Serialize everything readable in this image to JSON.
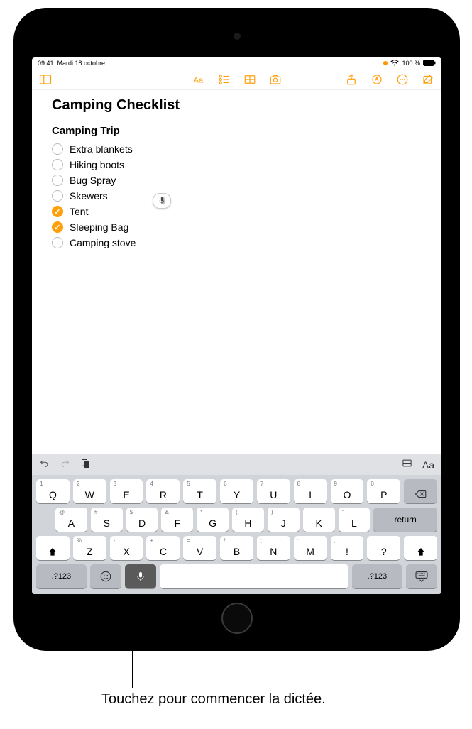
{
  "status": {
    "time": "09:41",
    "date": "Mardi 18 octobre",
    "battery": "100 %",
    "wifi": "wifi-icon"
  },
  "toolbar": {
    "left": [
      "sidebar-icon"
    ],
    "center": [
      "text-format-icon",
      "checklist-icon",
      "table-icon",
      "camera-icon"
    ],
    "right": [
      "share-icon",
      "markup-icon",
      "more-icon",
      "compose-icon"
    ]
  },
  "note": {
    "title": "Camping Checklist",
    "subtitle": "Camping Trip",
    "items": [
      {
        "label": "Extra blankets",
        "checked": false
      },
      {
        "label": "Hiking boots",
        "checked": false
      },
      {
        "label": "Bug Spray",
        "checked": false
      },
      {
        "label": "Skewers",
        "checked": false
      },
      {
        "label": "Tent",
        "checked": true
      },
      {
        "label": "Sleeping Bag",
        "checked": true
      },
      {
        "label": "Camping stove",
        "checked": false
      }
    ]
  },
  "kbd_toolbar": {
    "left": [
      "undo-icon",
      "redo-icon",
      "scan-icon"
    ],
    "right": [
      "table-icon",
      "text-format-icon"
    ]
  },
  "keyboard": {
    "row1": [
      {
        "main": "Q",
        "hint": "1"
      },
      {
        "main": "W",
        "hint": "2"
      },
      {
        "main": "E",
        "hint": "3"
      },
      {
        "main": "R",
        "hint": "4"
      },
      {
        "main": "T",
        "hint": "5"
      },
      {
        "main": "Y",
        "hint": "6"
      },
      {
        "main": "U",
        "hint": "7"
      },
      {
        "main": "I",
        "hint": "8"
      },
      {
        "main": "O",
        "hint": "9"
      },
      {
        "main": "P",
        "hint": "0"
      }
    ],
    "row2": [
      {
        "main": "A",
        "hint": "@"
      },
      {
        "main": "S",
        "hint": "#"
      },
      {
        "main": "D",
        "hint": "$"
      },
      {
        "main": "F",
        "hint": "&"
      },
      {
        "main": "G",
        "hint": "*"
      },
      {
        "main": "H",
        "hint": "("
      },
      {
        "main": "J",
        "hint": ")"
      },
      {
        "main": "K",
        "hint": "'"
      },
      {
        "main": "L",
        "hint": "\""
      }
    ],
    "row3": [
      {
        "main": "Z",
        "hint": "%"
      },
      {
        "main": "X",
        "hint": "-"
      },
      {
        "main": "C",
        "hint": "+"
      },
      {
        "main": "V",
        "hint": "="
      },
      {
        "main": "B",
        "hint": "/"
      },
      {
        "main": "N",
        "hint": ";"
      },
      {
        "main": "M",
        "hint": ":"
      },
      {
        "main": "!",
        "hint": ","
      },
      {
        "main": "?",
        "hint": "."
      }
    ],
    "return_label": "return",
    "numkey_label": ".?123",
    "delete_label": "delete",
    "shift_label": "shift",
    "emoji_label": "emoji",
    "mic_label": "dictate",
    "space_label": "space",
    "dismiss_label": "hide-keyboard"
  },
  "callout": "Touchez pour commencer la dictée."
}
